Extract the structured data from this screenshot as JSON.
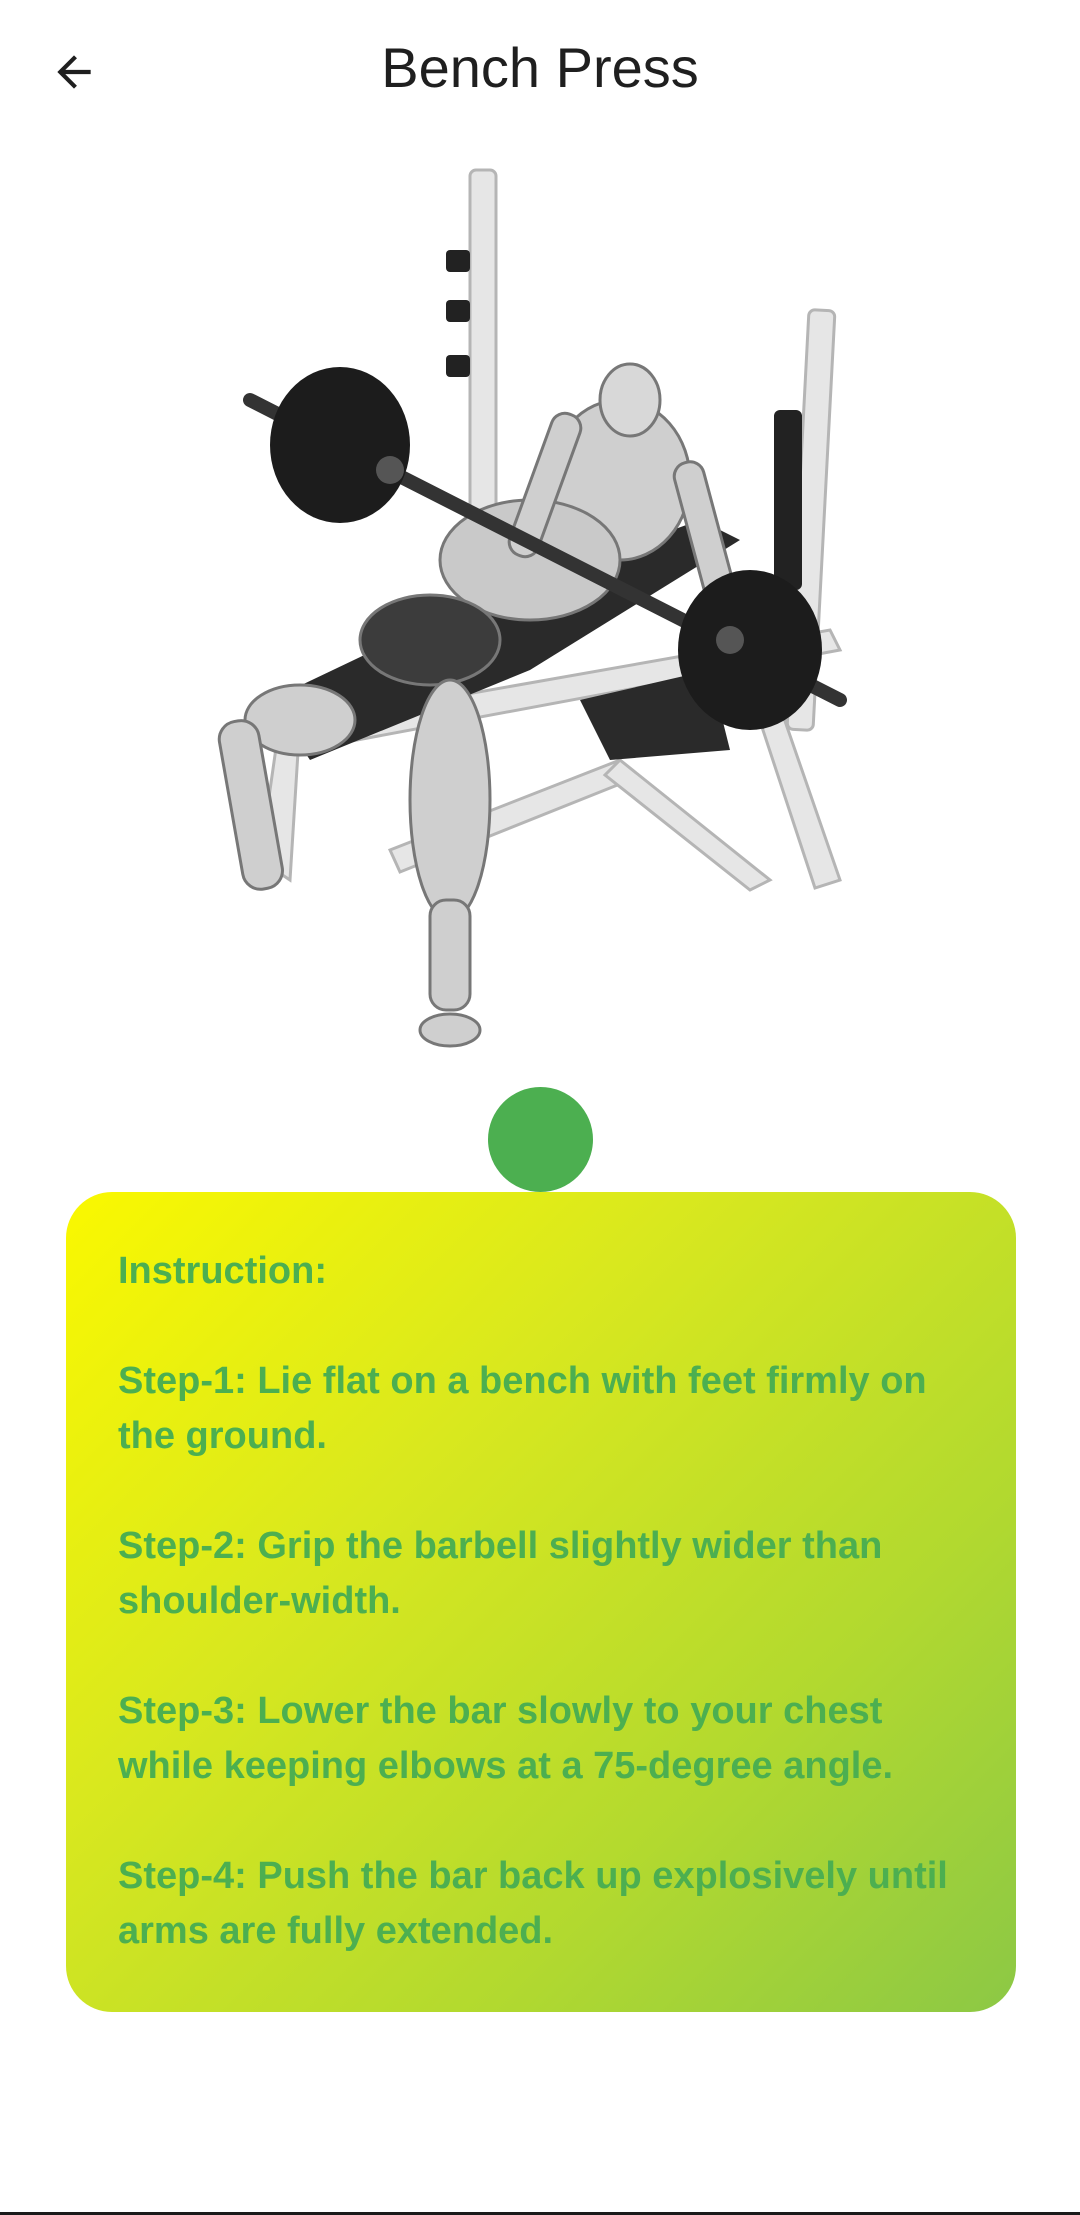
{
  "header": {
    "title": "Bench Press",
    "back_icon": "arrow-back-icon"
  },
  "illustration": {
    "icon": "bench-press-illustration"
  },
  "pager": {
    "active_color": "#4caf50"
  },
  "instructions": {
    "heading": "Instruction:",
    "steps": [
      "Step-1: Lie flat on a bench with feet firmly on the ground.",
      "Step-2: Grip the barbell slightly wider than shoulder-width.",
      "Step-3: Lower the bar slowly to your chest while keeping elbows at a 75-degree angle.",
      "Step-4: Push the bar back up explosively until arms are fully extended."
    ],
    "text_color": "#4caf50"
  }
}
